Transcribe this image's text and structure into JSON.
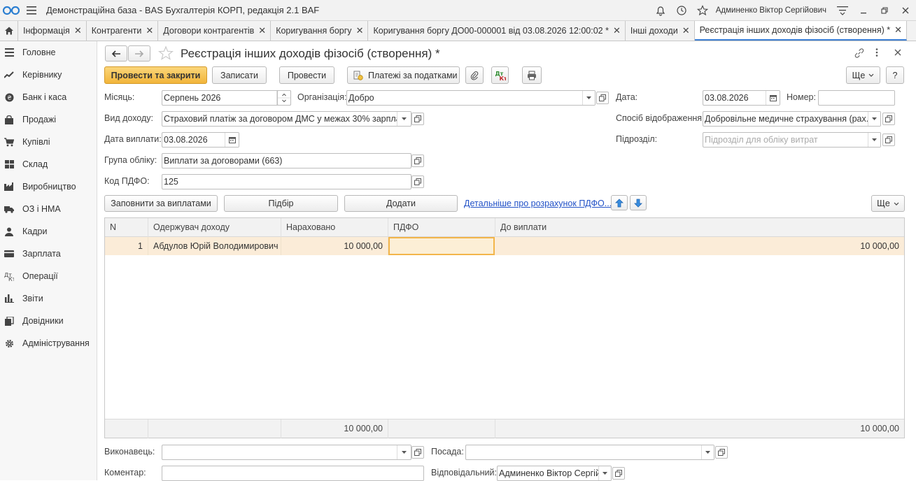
{
  "app": {
    "title": "Демонстраційна база - BAS Бухгалтерія КОРП, редакція 2.1 BAF",
    "user": "Админенко Віктор Сергійович"
  },
  "tabs": [
    {
      "label": "Інформація"
    },
    {
      "label": "Контрагенти"
    },
    {
      "label": "Договори контрагентів"
    },
    {
      "label": "Коригування боргу"
    },
    {
      "label": "Коригування боргу ДО00-000001 від 03.08.2026 12:00:02 *"
    },
    {
      "label": "Інші доходи"
    },
    {
      "label": "Реєстрація інших доходів фізосіб (створення) *"
    }
  ],
  "sidebar": {
    "items": [
      {
        "label": "Головне"
      },
      {
        "label": "Керівнику"
      },
      {
        "label": "Банк і каса"
      },
      {
        "label": "Продажі"
      },
      {
        "label": "Купівлі"
      },
      {
        "label": "Склад"
      },
      {
        "label": "Виробництво"
      },
      {
        "label": "ОЗ і НМА"
      },
      {
        "label": "Кадри"
      },
      {
        "label": "Зарплата"
      },
      {
        "label": "Операції"
      },
      {
        "label": "Звіти"
      },
      {
        "label": "Довідники"
      },
      {
        "label": "Адміністрування"
      }
    ]
  },
  "form": {
    "title": "Реєстрація інших доходів фізосіб (створення) *",
    "toolbar": {
      "post_close": "Провести та закрити",
      "save": "Записати",
      "post": "Провести",
      "tax_payments": "Платежі за податками",
      "more": "Ще",
      "help": "?"
    },
    "fields": {
      "month_label": "Місяць:",
      "month_value": "Серпень 2026",
      "org_label": "Організація:",
      "org_value": "Добро",
      "date_label": "Дата:",
      "date_value": "03.08.2026",
      "number_label": "Номер:",
      "number_value": "",
      "income_type_label": "Вид доходу:",
      "income_type_value": "Страховий платіж за договором ДМС у межах 30% зарплати",
      "display_method_label": "Спосіб відображення:",
      "display_method_value": "Добровільне медичне страхування (рах. 3",
      "pay_date_label": "Дата виплати:",
      "pay_date_value": "03.08.2026",
      "department_label": "Підрозділ:",
      "department_placeholder": "Підрозділ для обліку витрат",
      "account_group_label": "Група обліку:",
      "account_group_value": "Виплати за договорами (663)",
      "pdfo_code_label": "Код ПДФО:",
      "pdfo_code_value": "125",
      "executor_label": "Виконавець:",
      "executor_value": "",
      "position_label": "Посада:",
      "position_value": "",
      "comment_label": "Коментар:",
      "comment_value": "",
      "responsible_label": "Відповідальний:",
      "responsible_value": "Админенко Віктор Сергійс"
    },
    "table_toolbar": {
      "fill": "Заповнити за виплатами",
      "pick": "Підбір",
      "add": "Додати",
      "details_link": "Детальніше про розрахунок ПДФО...",
      "more": "Ще"
    },
    "table": {
      "columns": [
        "N",
        "Одержувач доходу",
        "Нараховано",
        "ПДФО",
        "До виплати"
      ],
      "rows": [
        {
          "n": "1",
          "recipient": "Абдулов Юрій Володимирович",
          "accrued": "10 000,00",
          "pdfo": "",
          "to_pay": "10 000,00"
        }
      ],
      "totals": {
        "accrued": "10 000,00",
        "to_pay": "10 000,00"
      }
    }
  },
  "colors": {
    "accent": "#3b7fd6",
    "primary_button": "#f2b53a",
    "selected_row": "#fbecd8"
  }
}
